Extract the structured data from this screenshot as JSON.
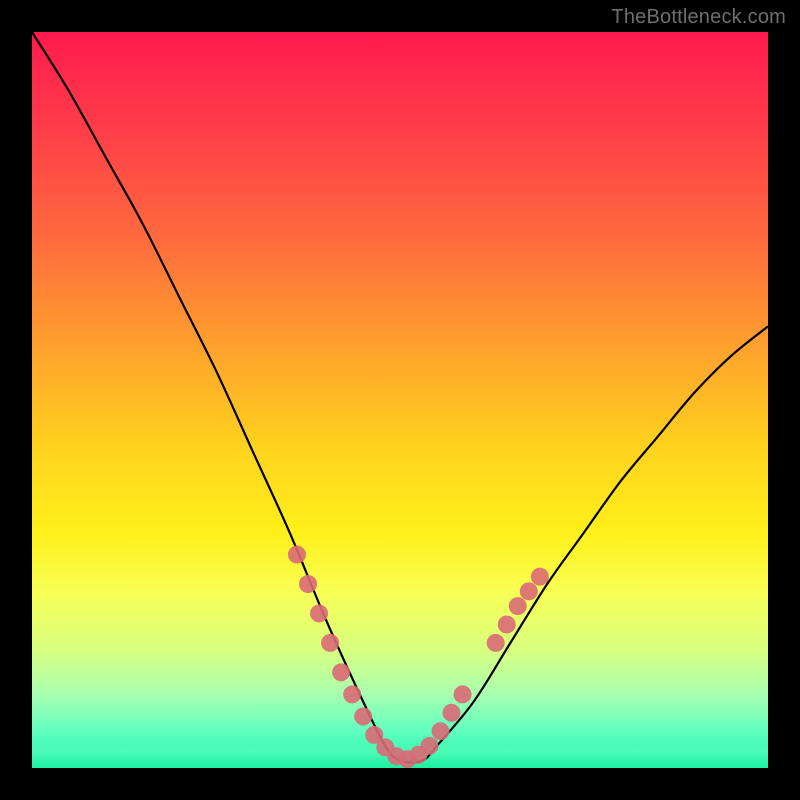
{
  "watermark": "TheBottleneck.com",
  "chart_data": {
    "type": "line",
    "title": "",
    "xlabel": "",
    "ylabel": "",
    "xlim": [
      0,
      100
    ],
    "ylim": [
      0,
      100
    ],
    "grid": false,
    "legend": false,
    "series": [
      {
        "name": "curve",
        "x": [
          0,
          5,
          10,
          15,
          20,
          25,
          30,
          35,
          40,
          45,
          48,
          50,
          53,
          55,
          60,
          65,
          70,
          75,
          80,
          85,
          90,
          95,
          100
        ],
        "y": [
          100,
          92,
          83,
          74,
          64,
          54,
          43,
          32,
          20,
          9,
          3,
          1,
          1,
          3,
          9,
          17,
          25,
          32,
          39,
          45,
          51,
          56,
          60
        ]
      }
    ],
    "markers": [
      {
        "x": 36,
        "y": 29
      },
      {
        "x": 37.5,
        "y": 25
      },
      {
        "x": 39,
        "y": 21
      },
      {
        "x": 40.5,
        "y": 17
      },
      {
        "x": 42,
        "y": 13
      },
      {
        "x": 43.5,
        "y": 10
      },
      {
        "x": 45,
        "y": 7
      },
      {
        "x": 46.5,
        "y": 4.5
      },
      {
        "x": 48,
        "y": 2.8
      },
      {
        "x": 49.5,
        "y": 1.6
      },
      {
        "x": 51,
        "y": 1.2
      },
      {
        "x": 52.5,
        "y": 1.8
      },
      {
        "x": 54,
        "y": 3
      },
      {
        "x": 55.5,
        "y": 5
      },
      {
        "x": 57,
        "y": 7.5
      },
      {
        "x": 58.5,
        "y": 10
      },
      {
        "x": 63,
        "y": 17
      },
      {
        "x": 64.5,
        "y": 19.5
      },
      {
        "x": 66,
        "y": 22
      },
      {
        "x": 67.5,
        "y": 24
      },
      {
        "x": 69,
        "y": 26
      }
    ],
    "marker_style": {
      "color": "#d96a75",
      "radius_px": 9
    },
    "background": {
      "type": "vertical_gradient",
      "stops": [
        {
          "pos": 0.0,
          "color": "#ff1a4d"
        },
        {
          "pos": 0.28,
          "color": "#ff6a3e"
        },
        {
          "pos": 0.56,
          "color": "#ffd11e"
        },
        {
          "pos": 0.76,
          "color": "#f8ff55"
        },
        {
          "pos": 1.0,
          "color": "#18f5a0"
        }
      ]
    }
  }
}
